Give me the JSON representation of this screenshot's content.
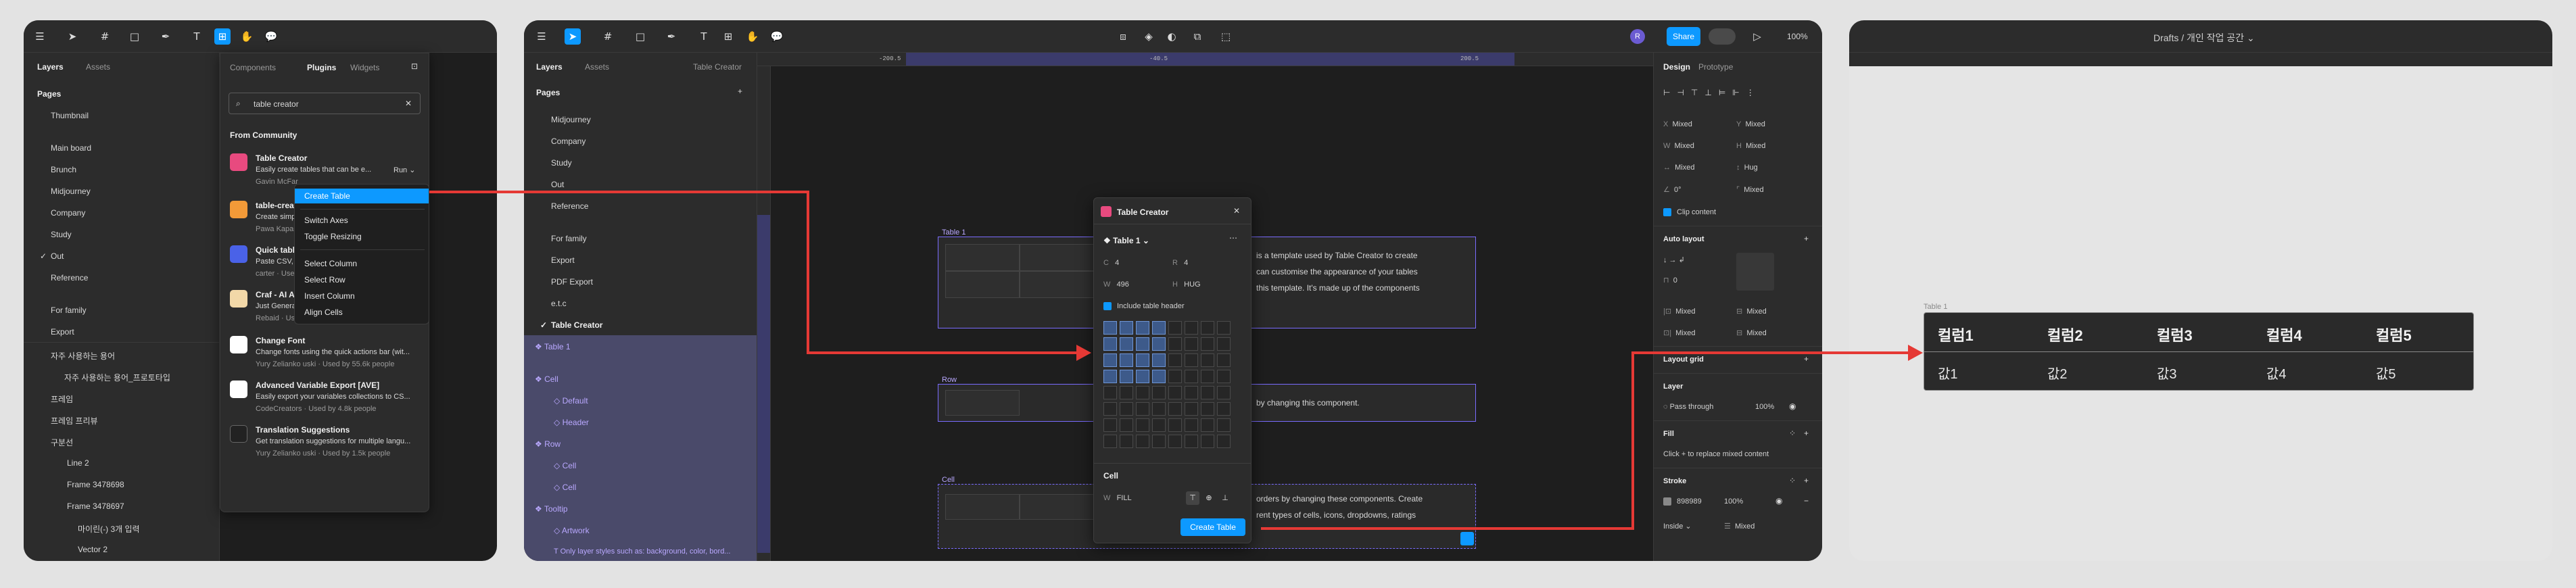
{
  "left_window": {
    "panel_tabs": [
      "Layers",
      "Assets"
    ],
    "pages_title": "Pages",
    "pages": [
      "Thumbnail",
      "Main board",
      "Brunch",
      "Midjourney",
      "Company",
      "Study",
      "Out",
      "Reference",
      "For family",
      "Export"
    ],
    "layers": [
      "자주 사용하는 용어",
      "자주 사용하는 용어_프로토타입",
      "프레임",
      "프레임 프리뷰",
      "구분선",
      "Line 2",
      "Frame 3478698",
      "Frame 3478697",
      "마이린(-) 3개 입력",
      "Vector 2"
    ],
    "plugin_tabs": [
      "Components",
      "Plugins",
      "Widgets"
    ],
    "search_value": "table creator",
    "section_title": "From Community",
    "plugins": [
      {
        "name": "Table Creator",
        "desc": "Easily create tables that can be e...",
        "author": "Gavin McFar",
        "run": "Run",
        "icon_color": "#e84a7f"
      },
      {
        "name": "table-creat",
        "desc": "Create simp",
        "author": "Pawa Kapasi",
        "icon_color": "#f29a38"
      },
      {
        "name": "Quick table",
        "desc": "Paste CSV, J",
        "author": "carter · Used",
        "icon_color": "#4a62e8"
      },
      {
        "name": "Craf - AI Ar",
        "desc": "Just Generat",
        "author": "Rebaid · Used by 6k people",
        "icon_color": "#f2d8a8"
      },
      {
        "name": "Change Font",
        "desc": "Change fonts using the quick actions bar (wit...",
        "author": "Yury Zelianko uski · Used by 55.6k people",
        "icon_color": "#ffffff"
      },
      {
        "name": "Advanced Variable Export [AVE]",
        "desc": "Easily export your variables collections to CS...",
        "author": "CodeCreators · Used by 4.8k people",
        "icon_color": "#ffffff"
      },
      {
        "name": "Translation Suggestions",
        "desc": "Get translation suggestions for multiple langu...",
        "author": "Yury Zelianko uski · Used by 1.5k people",
        "icon_color": "#222222"
      }
    ],
    "context_menu": [
      "Create Table",
      "Switch Axes",
      "Toggle Resizing",
      "Select Column",
      "Select Row",
      "Insert Column",
      "Align Cells"
    ]
  },
  "middle_window": {
    "share_label": "Share",
    "zoom": "100%",
    "avatar": "R",
    "panel_tabs": [
      "Layers",
      "Assets"
    ],
    "file_name": "Table Creator",
    "pages_title": "Pages",
    "pages": [
      "Midjourney",
      "Company",
      "Study",
      "Out",
      "Reference",
      "For family",
      "Export",
      "PDF Export",
      "e.t.c",
      "Table Creator"
    ],
    "layers": [
      {
        "label": "Table 1",
        "kind": "section"
      },
      {
        "label": "Cell",
        "kind": "section"
      },
      {
        "label": "Default",
        "kind": "item"
      },
      {
        "label": "Header",
        "kind": "item"
      },
      {
        "label": "Row",
        "kind": "section"
      },
      {
        "label": "Cell",
        "kind": "item"
      },
      {
        "label": "Cell",
        "kind": "item"
      },
      {
        "label": "Tooltip",
        "kind": "section"
      },
      {
        "label": "Artwork",
        "kind": "item"
      },
      {
        "label": "Only layer styles such as: background, color, bord...",
        "kind": "item"
      }
    ],
    "ruler_marks": [
      "-200.5",
      "-40.5",
      "200.5"
    ],
    "canvas_frames": [
      "Table 1",
      "Row",
      "Cell"
    ],
    "canvas_text_1": [
      "is a template used by Table Creator to create",
      "can customise the appearance of your tables",
      "this template. It's made up of the components"
    ],
    "canvas_text_2": "by changing this component.",
    "canvas_text_3": [
      "orders by changing these components. Create",
      "rent types of cells, icons, dropdowns, ratings"
    ],
    "dialog": {
      "title": "Table Creator",
      "table_name": "Table 1",
      "c_label": "C",
      "c_value": "4",
      "r_label": "R",
      "r_value": "4",
      "w_label": "W",
      "w_value": "496",
      "h_label": "H",
      "h_value": "HUG",
      "header_checkbox": "Include table header",
      "selected_cols": 4,
      "selected_rows": 4,
      "cell_title": "Cell",
      "cell_w_label": "W",
      "cell_w_value": "FILL",
      "create_button": "Create Table"
    },
    "right_panel": {
      "tabs": [
        "Design",
        "Prototype"
      ],
      "x_label": "X",
      "x_value": "Mixed",
      "y_label": "Y",
      "y_value": "Mixed",
      "w_label": "W",
      "w_value": "Mixed",
      "h_label": "H",
      "h_value": "Mixed",
      "w2_value": "Mixed",
      "hug_value": "Hug",
      "rot_value": "0°",
      "rot2_value": "Mixed",
      "clip": "Clip content",
      "auto_layout": "Auto layout",
      "gap_value": "0",
      "pad1": "Mixed",
      "pad2": "Mixed",
      "pad3": "Mixed",
      "pad4": "Mixed",
      "layout_grid": "Layout grid",
      "layer": "Layer",
      "blend": "Pass through",
      "opacity": "100%",
      "fill": "Fill",
      "fill_hint": "Click + to replace mixed content",
      "stroke": "Stroke",
      "stroke_hex": "898989",
      "stroke_opacity": "100%",
      "stroke_pos": "Inside",
      "stroke_w": "Mixed"
    }
  },
  "right_window": {
    "breadcrumb": "Drafts / 개인 작업 공간",
    "frame_label": "Table 1",
    "headers": [
      "컬럼1",
      "컬럼2",
      "컬럼3",
      "컬럼4",
      "컬럼5"
    ],
    "values": [
      "값1",
      "값2",
      "값3",
      "값4",
      "값5"
    ]
  }
}
